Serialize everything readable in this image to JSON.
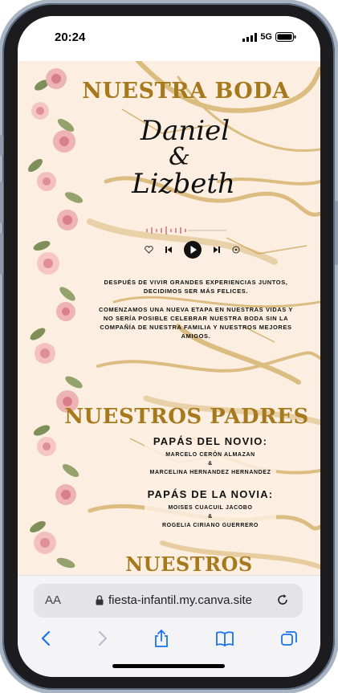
{
  "status_bar": {
    "time": "20:24",
    "network": "5G"
  },
  "hero": {
    "title": "NUESTRA BODA",
    "name1": "Daniel",
    "amp": "&",
    "name2": "Lizbeth"
  },
  "player": {
    "icons": [
      "heart-icon",
      "prev-icon",
      "play-icon",
      "next-icon",
      "share-icon"
    ]
  },
  "intro": {
    "p1": "DESPUÉS DE VIVIR GRANDES EXPERIENCIAS JUNTOS, DECIDIMOS SER MÁS FELICES.",
    "p2": "COMENZAMOS UNA NUEVA ETAPA EN NUESTRAS VIDAS Y NO SERÍA POSIBLE CELEBRAR NUESTRA BODA SIN LA COMPAÑÍA DE NUESTRA FAMILIA Y NUESTROS MEJORES AMIGOS."
  },
  "parents": {
    "title": "NUESTROS PADRES",
    "groom_heading": "PAPÁS DEL NOVIO:",
    "groom_father": "MARCELO CERÓN ALMAZAN",
    "groom_amp": "&",
    "groom_mother": "MARCELINA HERNANDEZ HERNANDEZ",
    "bride_heading": "PAPÁS DE LA NOVIA:",
    "bride_father": "MOISES CUACUIL JACOBO",
    "bride_amp": "&",
    "bride_mother": "ROGELIA CIRIANO GUERRERO"
  },
  "next_section": {
    "title": "NUESTROS"
  },
  "browser": {
    "text_size": "AA",
    "url": "fiesta-infantil.my.canva.site"
  },
  "colors": {
    "gold": "#a6791d",
    "cream": "#fdf0e2",
    "rose": "#e8a0a6",
    "leaf": "#7f8f5a"
  }
}
